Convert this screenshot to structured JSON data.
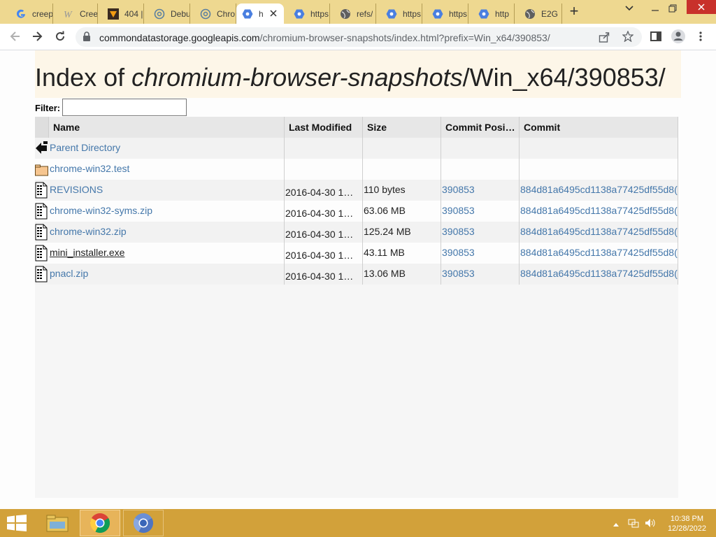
{
  "tabs": [
    {
      "title": "creep",
      "icon": "google-icon"
    },
    {
      "title": "Creep",
      "icon": "w-icon"
    },
    {
      "title": "404 |",
      "icon": "error-icon"
    },
    {
      "title": "Debu",
      "icon": "chrome-outline-icon"
    },
    {
      "title": "Chro",
      "icon": "chrome-outline-icon"
    },
    {
      "title": "h",
      "icon": "hexagon-icon",
      "active": true
    },
    {
      "title": "https",
      "icon": "hexagon-icon"
    },
    {
      "title": "refs/",
      "icon": "globe-icon"
    },
    {
      "title": "https",
      "icon": "hexagon-icon"
    },
    {
      "title": "https",
      "icon": "hexagon-icon"
    },
    {
      "title": "http",
      "icon": "hexagon-icon"
    },
    {
      "title": "E2G",
      "icon": "globe-icon"
    }
  ],
  "omnibox": {
    "host": "commondatastorage.googleapis.com",
    "path": "/chromium-browser-snapshots/index.html?prefix=Win_x64/390853/"
  },
  "page": {
    "title_prefix": "Index of ",
    "title_italic": "chromium-browser-snapshots",
    "title_suffix": "/Win_x64/390853/",
    "filter_label": "Filter:"
  },
  "table": {
    "columns": [
      "Name",
      "Last Modified",
      "Size",
      "Commit Posi…",
      "Commit"
    ],
    "rows": [
      {
        "name": "Parent Directory",
        "type": "parent",
        "modified": "",
        "size": "",
        "position": "",
        "commit": ""
      },
      {
        "name": "chrome-win32.test",
        "type": "folder",
        "modified": "",
        "size": "",
        "position": "",
        "commit": ""
      },
      {
        "name": "REVISIONS",
        "type": "file",
        "modified": "2016-04-30 1…",
        "size": "110 bytes",
        "position": "390853",
        "commit": "884d81a6495cd1138a77425df55d8("
      },
      {
        "name": "chrome-win32-syms.zip",
        "type": "file",
        "modified": "2016-04-30 1…",
        "size": "63.06 MB",
        "position": "390853",
        "commit": "884d81a6495cd1138a77425df55d8("
      },
      {
        "name": "chrome-win32.zip",
        "type": "file",
        "modified": "2016-04-30 1…",
        "size": "125.24 MB",
        "position": "390853",
        "commit": "884d81a6495cd1138a77425df55d8("
      },
      {
        "name": "mini_installer.exe",
        "type": "file",
        "modified": "2016-04-30 1…",
        "size": "43.11 MB",
        "position": "390853",
        "commit": "884d81a6495cd1138a77425df55d8(",
        "hover": true
      },
      {
        "name": "pnacl.zip",
        "type": "file",
        "modified": "2016-04-30 1…",
        "size": "13.06 MB",
        "position": "390853",
        "commit": "884d81a6495cd1138a77425df55d8("
      }
    ]
  },
  "taskbar": {
    "time": "10:38 PM",
    "date": "12/28/2022"
  }
}
